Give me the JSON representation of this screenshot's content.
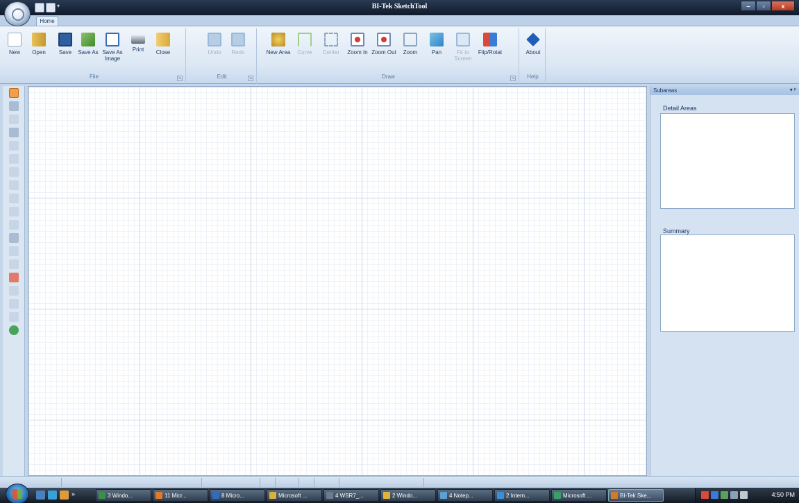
{
  "window": {
    "title": "BI-Tek SketchTool"
  },
  "window_controls": {
    "minimize": "‒",
    "maximize": "▫",
    "close": "x"
  },
  "tabs": [
    {
      "label": "Home"
    }
  ],
  "ribbon": {
    "groups": [
      {
        "label": "File",
        "buttons": [
          {
            "label": "New",
            "icon": "new-file-icon"
          },
          {
            "label": "Open",
            "icon": "open-folder-icon"
          },
          {
            "label": "Save",
            "icon": "save-disk-icon"
          },
          {
            "label": "Save As",
            "icon": "save-as-icon"
          },
          {
            "label": "Save As Image",
            "icon": "save-image-icon"
          },
          {
            "label": "Print",
            "icon": "printer-icon"
          },
          {
            "label": "Close",
            "icon": "close-file-icon"
          }
        ]
      },
      {
        "label": "Edit",
        "buttons": [
          {
            "label": "Undo",
            "icon": "undo-icon",
            "disabled": true
          },
          {
            "label": "Redo",
            "icon": "redo-icon",
            "disabled": true
          }
        ]
      },
      {
        "label": "Draw",
        "buttons": [
          {
            "label": "New Area",
            "icon": "new-area-icon"
          },
          {
            "label": "Curve",
            "icon": "curve-icon",
            "disabled": true
          },
          {
            "label": "Center",
            "icon": "center-icon",
            "disabled": true
          },
          {
            "label": "Zoom In",
            "icon": "zoom-in-icon"
          },
          {
            "label": "Zoom Out",
            "icon": "zoom-out-icon"
          },
          {
            "label": "Zoom",
            "icon": "zoom-icon"
          },
          {
            "label": "Pan",
            "icon": "pan-icon"
          },
          {
            "label": "Fit to Screen",
            "icon": "fit-to-screen-icon",
            "disabled": true
          },
          {
            "label": "Flip/Rotat",
            "icon": "flip-rotate-icon"
          }
        ]
      },
      {
        "label": "Help",
        "buttons": [
          {
            "label": "About",
            "icon": "about-icon"
          }
        ]
      }
    ]
  },
  "right_pane": {
    "title": "Subareas",
    "controls": "▾ ᵖ",
    "sections": [
      {
        "label": "Detail Areas"
      },
      {
        "label": "Summary"
      }
    ]
  },
  "taskbar": {
    "items": [
      {
        "label": "3 Windo...",
        "color": "#3a8f4a"
      },
      {
        "label": "11 Micr...",
        "color": "#e07a2a"
      },
      {
        "label": "8 Micro...",
        "color": "#2f6bc0"
      },
      {
        "label": "Microsoft ...",
        "color": "#d9b23a"
      },
      {
        "label": "4 WSR7_...",
        "color": "#6b7a8c"
      },
      {
        "label": "2 Windo...",
        "color": "#e0b43a"
      },
      {
        "label": "4 Notep...",
        "color": "#5aa0d0"
      },
      {
        "label": "2 Intern...",
        "color": "#3a8fd9"
      },
      {
        "label": "Microsoft ...",
        "color": "#3aa06a"
      },
      {
        "label": "BI-Tek Ske...",
        "color": "#d07a2a",
        "active": true
      }
    ],
    "clock": "4:50 PM"
  }
}
